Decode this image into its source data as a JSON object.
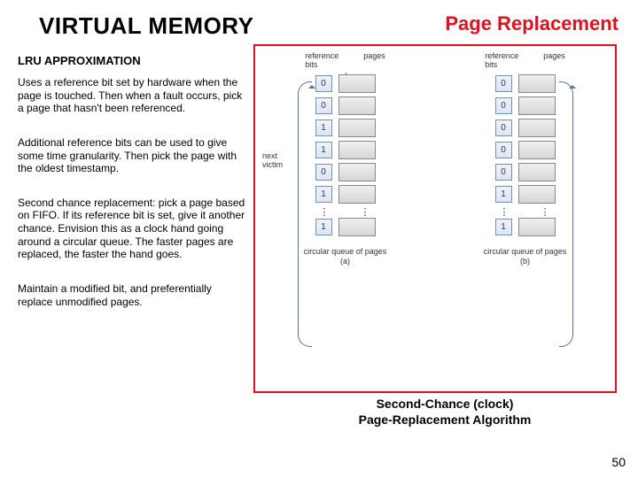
{
  "title": "VIRTUAL MEMORY",
  "topic": "Page Replacement",
  "subhead": "LRU APPROXIMATION",
  "paragraphs": {
    "p1": "Uses a reference bit set by hardware when the page is touched. Then when a fault occurs, pick a page that hasn't been referenced.",
    "p2": "Additional reference bits can be used to give some time granularity. Then pick the page with the oldest timestamp.",
    "p3": "Second chance replacement: pick a page based on FIFO. If its reference bit is set, give it another chance. Envision this as a clock hand going around a circular queue. The faster pages are replaced, the faster the hand goes.",
    "p4": "Maintain a modified bit, and preferentially replace unmodified pages."
  },
  "figure": {
    "headers": {
      "ref": "reference",
      "bits": "bits",
      "pages": "pages"
    },
    "victim_label": "next\nvictim",
    "col_a": {
      "bits": [
        "0",
        "0",
        "1",
        "1",
        "0",
        "1",
        "1"
      ],
      "sub": "circular queue of pages",
      "tag": "(a)"
    },
    "col_b": {
      "bits": [
        "0",
        "0",
        "0",
        "0",
        "0",
        "1",
        "1"
      ],
      "sub": "circular queue of pages",
      "tag": "(b)"
    },
    "caption_l1": "Second-Chance (clock)",
    "caption_l2": "Page-Replacement Algorithm"
  },
  "page_number": "50"
}
